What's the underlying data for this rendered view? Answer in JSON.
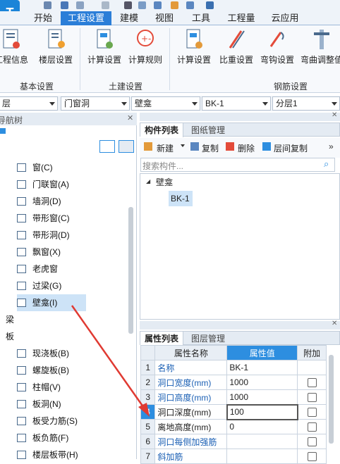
{
  "ribbon_tabs": [
    "开始",
    "工程设置",
    "建模",
    "视图",
    "工具",
    "工程量",
    "云应用"
  ],
  "ribbon_buttons": {
    "project_info": "工程信息",
    "floor_settings": "楼层设置",
    "calc_settings": "计算设置",
    "calc_rules": "计算规则",
    "calc_settings2": "计算设置",
    "weight_settings": "比重设置",
    "hook_settings": "弯钩设置",
    "bend_settings": "弯曲调整值"
  },
  "ribbon_groups": {
    "basic": "基本设置",
    "civil": "土建设置",
    "rebar": "钢筋设置"
  },
  "combos": [
    "层",
    "门窗洞",
    "壁龛",
    "BK-1",
    "分层1"
  ],
  "nav_title": "导航树",
  "nav_items": [
    {
      "label": "窗(C)",
      "icon": "window-icon"
    },
    {
      "label": "门联窗(A)",
      "icon": "door-window-icon"
    },
    {
      "label": "墙洞(D)",
      "icon": "wall-hole-icon"
    },
    {
      "label": "带形窗(C)",
      "icon": "strip-window-icon"
    },
    {
      "label": "带形洞(D)",
      "icon": "strip-hole-icon"
    },
    {
      "label": "飘窗(X)",
      "icon": "bay-window-icon"
    },
    {
      "label": "老虎窗",
      "icon": "dormer-icon"
    },
    {
      "label": "过梁(G)",
      "icon": "lintel-icon"
    },
    {
      "label": "壁龛(I)",
      "icon": "niche-icon"
    }
  ],
  "nav_groups": [
    "梁",
    "板"
  ],
  "nav_items2": [
    {
      "label": "现浇板(B)",
      "icon": "slab-icon"
    },
    {
      "label": "螺旋板(B)",
      "icon": "spiral-slab-icon"
    },
    {
      "label": "柱帽(V)",
      "icon": "column-cap-icon"
    },
    {
      "label": "板洞(N)",
      "icon": "slab-hole-icon"
    },
    {
      "label": "板受力筋(S)",
      "icon": "slab-rebar-icon"
    },
    {
      "label": "板负筋(F)",
      "icon": "neg-rebar-icon"
    },
    {
      "label": "楼层板带(H)",
      "icon": "slab-band-icon"
    }
  ],
  "component_pane": {
    "tab_active": "构件列表",
    "tab_other": "图纸管理",
    "new": "新建",
    "copy": "复制",
    "delete": "删除",
    "floor_copy": "层间复制",
    "search_placeholder": "搜索构件...",
    "tree_root": "壁龛",
    "tree_child": "BK-1"
  },
  "props_pane": {
    "tab_active": "属性列表",
    "tab_other": "图层管理",
    "col_name": "属性名称",
    "col_value": "属性值",
    "col_extra": "附加",
    "rows": [
      {
        "n": "1",
        "name": "名称",
        "value": "BK-1",
        "blue": true,
        "check": false
      },
      {
        "n": "2",
        "name": "洞口宽度(mm)",
        "value": "1000",
        "blue": true,
        "check": true
      },
      {
        "n": "3",
        "name": "洞口高度(mm)",
        "value": "1000",
        "blue": true,
        "check": true
      },
      {
        "n": "4",
        "name": "洞口深度(mm)",
        "value": "100",
        "blue": false,
        "check": true
      },
      {
        "n": "5",
        "name": "离地高度(mm)",
        "value": "0",
        "blue": false,
        "check": true
      },
      {
        "n": "6",
        "name": "洞口每侧加强筋",
        "value": "",
        "blue": true,
        "check": true
      },
      {
        "n": "7",
        "name": "斜加筋",
        "value": "",
        "blue": true,
        "check": true
      }
    ]
  }
}
